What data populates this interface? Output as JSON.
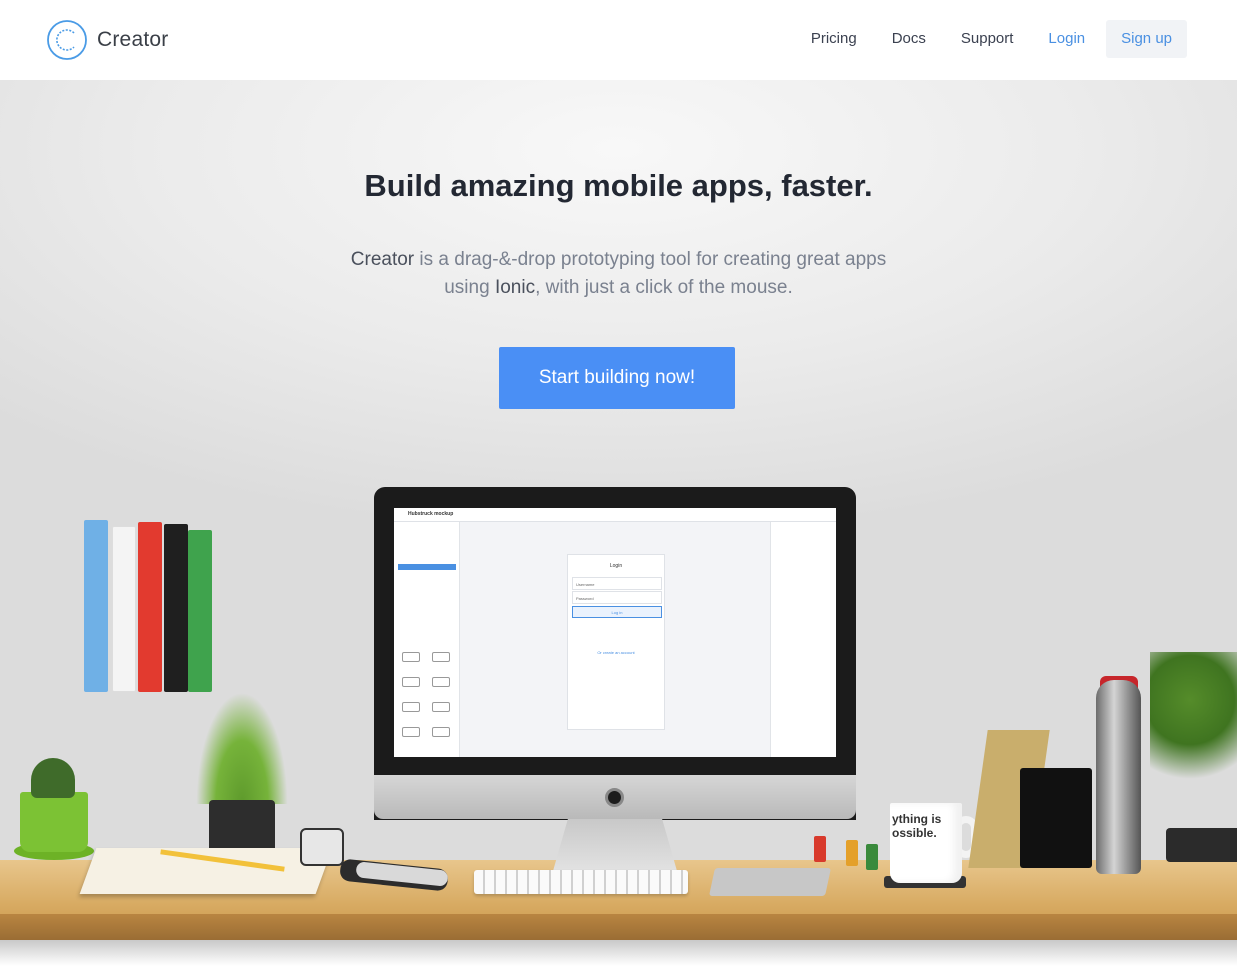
{
  "header": {
    "brand": "Creator",
    "nav": {
      "pricing": "Pricing",
      "docs": "Docs",
      "support": "Support",
      "login": "Login",
      "signup": "Sign up"
    }
  },
  "hero": {
    "title": "Build amazing mobile apps, faster.",
    "subtitle": {
      "strong1": "Creator",
      "part1": " is a drag-&-drop prototyping tool for creating great apps using ",
      "strong2": "Ionic",
      "part2": ", with just a click of the mouse."
    },
    "cta": "Start building now!"
  },
  "screen": {
    "app_title": "Hubstruck mockup",
    "phone_title": "Login",
    "username": "Username",
    "password": "Password",
    "login_button": "Log in",
    "create_link": "Or create an account"
  },
  "mug_text": "ything is\nossible.",
  "colors": {
    "accent": "#4a8ff5",
    "link": "#4a90e2",
    "title": "#232833",
    "muted": "#7a818f"
  }
}
